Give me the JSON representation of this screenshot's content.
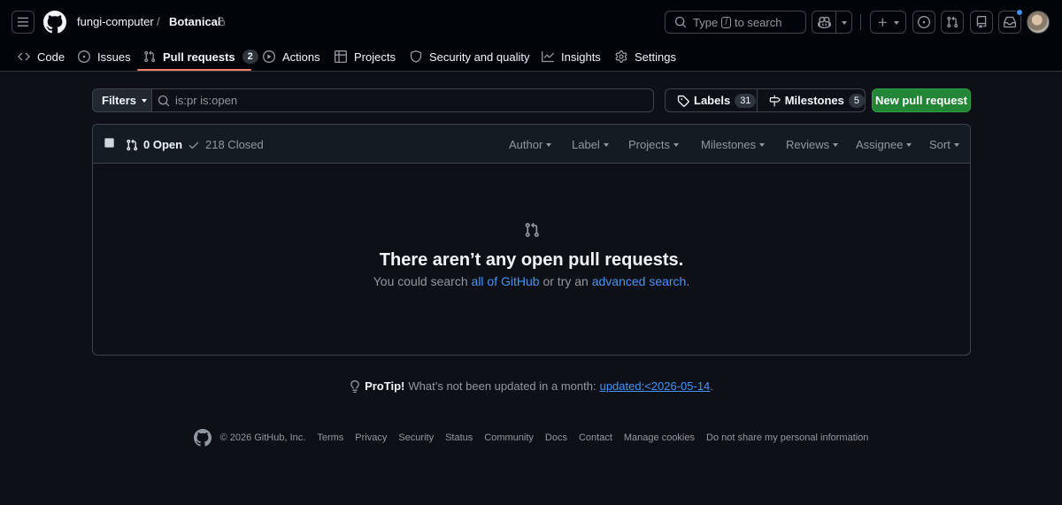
{
  "header": {
    "owner": "fungi-computer",
    "separator": "/",
    "repo": "Botanical",
    "search_prefix": "Type",
    "search_key": "/",
    "search_suffix": "to search"
  },
  "repo_nav": {
    "code": "Code",
    "issues": "Issues",
    "pull_requests": "Pull requests",
    "pull_requests_count": "2",
    "actions": "Actions",
    "projects": "Projects",
    "security": "Security and quality",
    "insights": "Insights",
    "settings": "Settings"
  },
  "filter_bar": {
    "filters_label": "Filters",
    "query": "is:pr is:open",
    "labels_label": "Labels",
    "labels_count": "31",
    "milestones_label": "Milestones",
    "milestones_count": "5",
    "new_pr_label": "New pull request"
  },
  "list_header": {
    "open_label": "0 Open",
    "closed_label": "218 Closed",
    "author": "Author",
    "label": "Label",
    "projects": "Projects",
    "milestones": "Milestones",
    "reviews": "Reviews",
    "assignee": "Assignee",
    "sort": "Sort"
  },
  "blankslate": {
    "title": "There aren’t any open pull requests.",
    "text_before": "You could search",
    "link_all": "all of GitHub",
    "text_middle": "or try an",
    "link_advanced": "advanced search",
    "text_after": "."
  },
  "protip": {
    "label": "ProTip!",
    "text": "What’s not been updated in a month:",
    "link": "updated:<2026-05-14",
    "end": "."
  },
  "footer": {
    "copyright": "© 2026 GitHub, Inc.",
    "links": [
      "Terms",
      "Privacy",
      "Security",
      "Status",
      "Community",
      "Docs",
      "Contact",
      "Manage cookies",
      "Do not share my personal information"
    ]
  },
  "colors": {
    "background": "#0d1117",
    "header_bg": "#010409",
    "accent_link": "#4493f8",
    "primary_button": "#238636",
    "active_tab_underline": "#f78166"
  },
  "icons": [
    "menu-icon",
    "github-logo-icon",
    "lock-icon",
    "search-icon",
    "copilot-icon",
    "plus-icon",
    "issue-icon",
    "pull-request-icon",
    "repo-icon",
    "inbox-icon",
    "code-icon",
    "play-icon",
    "table-icon",
    "shield-icon",
    "graph-icon",
    "gear-icon",
    "tag-icon",
    "milestone-icon",
    "check-icon",
    "light-bulb-icon"
  ]
}
